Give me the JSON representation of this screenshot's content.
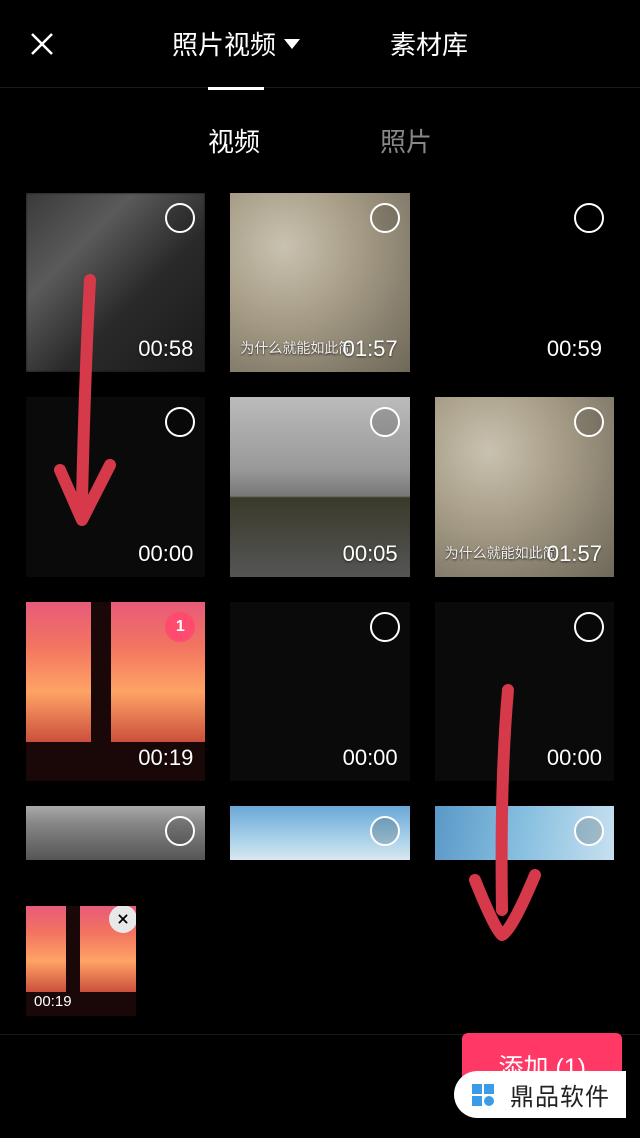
{
  "header": {
    "tabs": [
      {
        "label": "照片视频",
        "active": true,
        "hasDropdown": true
      },
      {
        "label": "素材库",
        "active": false,
        "hasDropdown": false
      }
    ]
  },
  "subTabs": [
    {
      "label": "视频",
      "active": true
    },
    {
      "label": "照片",
      "active": false
    }
  ],
  "videos": [
    {
      "duration": "00:58",
      "thumb": "blur",
      "selected": false,
      "selectedIndex": null,
      "caption": ""
    },
    {
      "duration": "01:57",
      "thumb": "rock",
      "selected": false,
      "selectedIndex": null,
      "caption": "为什么就能如此简单"
    },
    {
      "duration": "00:59",
      "thumb": "black",
      "selected": false,
      "selectedIndex": null,
      "caption": ""
    },
    {
      "duration": "00:00",
      "thumb": "dark",
      "selected": false,
      "selectedIndex": null,
      "caption": ""
    },
    {
      "duration": "00:05",
      "thumb": "cityscape",
      "selected": false,
      "selectedIndex": null,
      "caption": ""
    },
    {
      "duration": "01:57",
      "thumb": "rock",
      "selected": false,
      "selectedIndex": null,
      "caption": "为什么就能如此简单"
    },
    {
      "duration": "00:19",
      "thumb": "sunset",
      "selected": true,
      "selectedIndex": "1",
      "caption": ""
    },
    {
      "duration": "00:00",
      "thumb": "dark",
      "selected": false,
      "selectedIndex": null,
      "caption": ""
    },
    {
      "duration": "00:00",
      "thumb": "dark",
      "selected": false,
      "selectedIndex": null,
      "caption": ""
    },
    {
      "duration": "",
      "thumb": "gray",
      "selected": false,
      "selectedIndex": null,
      "caption": "",
      "short": true
    },
    {
      "duration": "",
      "thumb": "sky",
      "selected": false,
      "selectedIndex": null,
      "caption": "",
      "short": true
    },
    {
      "duration": "",
      "thumb": "sky2",
      "selected": false,
      "selectedIndex": null,
      "caption": "",
      "short": true
    }
  ],
  "selectedTray": [
    {
      "duration": "00:19",
      "thumb": "sunset"
    }
  ],
  "addButton": {
    "label": "添加 (1)"
  },
  "watermark": {
    "text": "鼎品软件"
  }
}
